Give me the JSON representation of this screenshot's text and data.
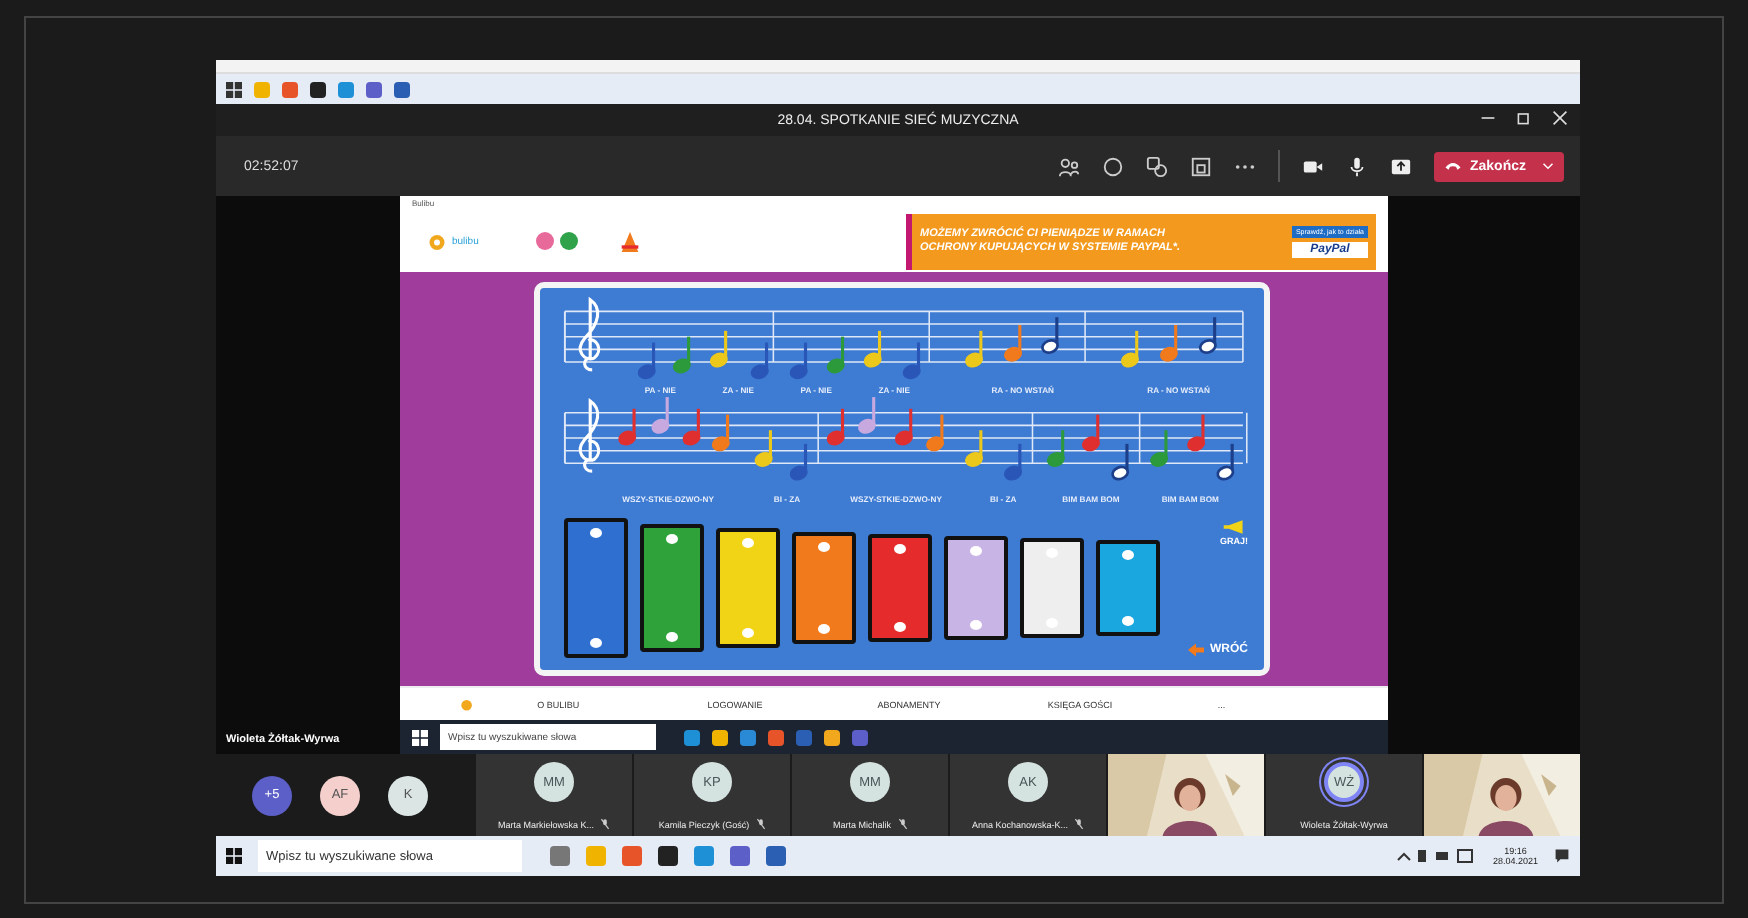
{
  "meeting": {
    "title": "28.04. SPOTKANIE SIEĆ MUZYCZNA",
    "timer": "02:52:07",
    "end_button": "Zakończ"
  },
  "shared_screen": {
    "browser_title": "Bulibu",
    "site_logo": "bulibu",
    "ad": {
      "headline_1": "MOŻEMY ZWRÓCIĆ CI PIENIĄDZE W RAMACH",
      "headline_2": "OCHRONY KUPUJĄCYCH W SYSTEMIE PAYPAL*.",
      "link": "Sprawdź, jak to działa",
      "brand": "PayPal"
    },
    "lyrics": [
      [
        "PA - NIE",
        "ZA - NIE",
        "PA - NIE",
        "ZA - NIE",
        "RA - NO WSTAŃ",
        "RA - NO WSTAŃ"
      ],
      [
        "WSZY-STKIE-DZWO-NY",
        "BI - ZA",
        "WSZY-STKIE-DZWO-NY",
        "BI - ZA",
        "BIM BAM BOM",
        "BIM BAM BOM"
      ]
    ],
    "xylophone": [
      {
        "color": "#2f6fd0"
      },
      {
        "color": "#2fa33a"
      },
      {
        "color": "#f2d417"
      },
      {
        "color": "#f07a1c"
      },
      {
        "color": "#e52b2b"
      },
      {
        "color": "#c9b4e6"
      },
      {
        "color": "#eeeeee"
      },
      {
        "color": "#1aa6de"
      }
    ],
    "play_label": "GRAJ!",
    "back_label": "WRÓĆ",
    "nav": [
      "O BULIBU",
      "LOGOWANIE",
      "ABONAMENTY",
      "KSIĘGA GOŚCI",
      "..."
    ],
    "taskbar_search": {
      "placeholder": "Wpisz tu wyszukiwane słowa"
    }
  },
  "presenter_name": "Wioleta Żółtak-Wyrwa",
  "participants": [
    {
      "kind": "count",
      "label": "+5"
    },
    {
      "kind": "avatar",
      "initials": "AF",
      "color": "#f5cfcc"
    },
    {
      "kind": "avatar",
      "initials": "K",
      "color": "#dbe6e4"
    },
    {
      "kind": "tile",
      "initials": "MM",
      "name": "Marta Markiełowska K...",
      "muted": true,
      "speaking": false
    },
    {
      "kind": "tile",
      "initials": "KP",
      "name": "Kamila Pieczyk (Gość)",
      "muted": true,
      "speaking": false
    },
    {
      "kind": "tile",
      "initials": "MM",
      "name": "Marta Michalik",
      "muted": true,
      "speaking": false
    },
    {
      "kind": "tile",
      "initials": "AK",
      "name": "Anna Kochanowska-K...",
      "muted": true,
      "speaking": false
    },
    {
      "kind": "video"
    },
    {
      "kind": "tile",
      "initials": "WŻ",
      "name": "Wioleta Żółtak-Wyrwa",
      "muted": false,
      "speaking": true
    },
    {
      "kind": "video"
    }
  ],
  "taskbar": {
    "search": {
      "placeholder": "Wpisz tu wyszukiwane słowa"
    },
    "time": "19:16",
    "date": "28.04.2021"
  }
}
